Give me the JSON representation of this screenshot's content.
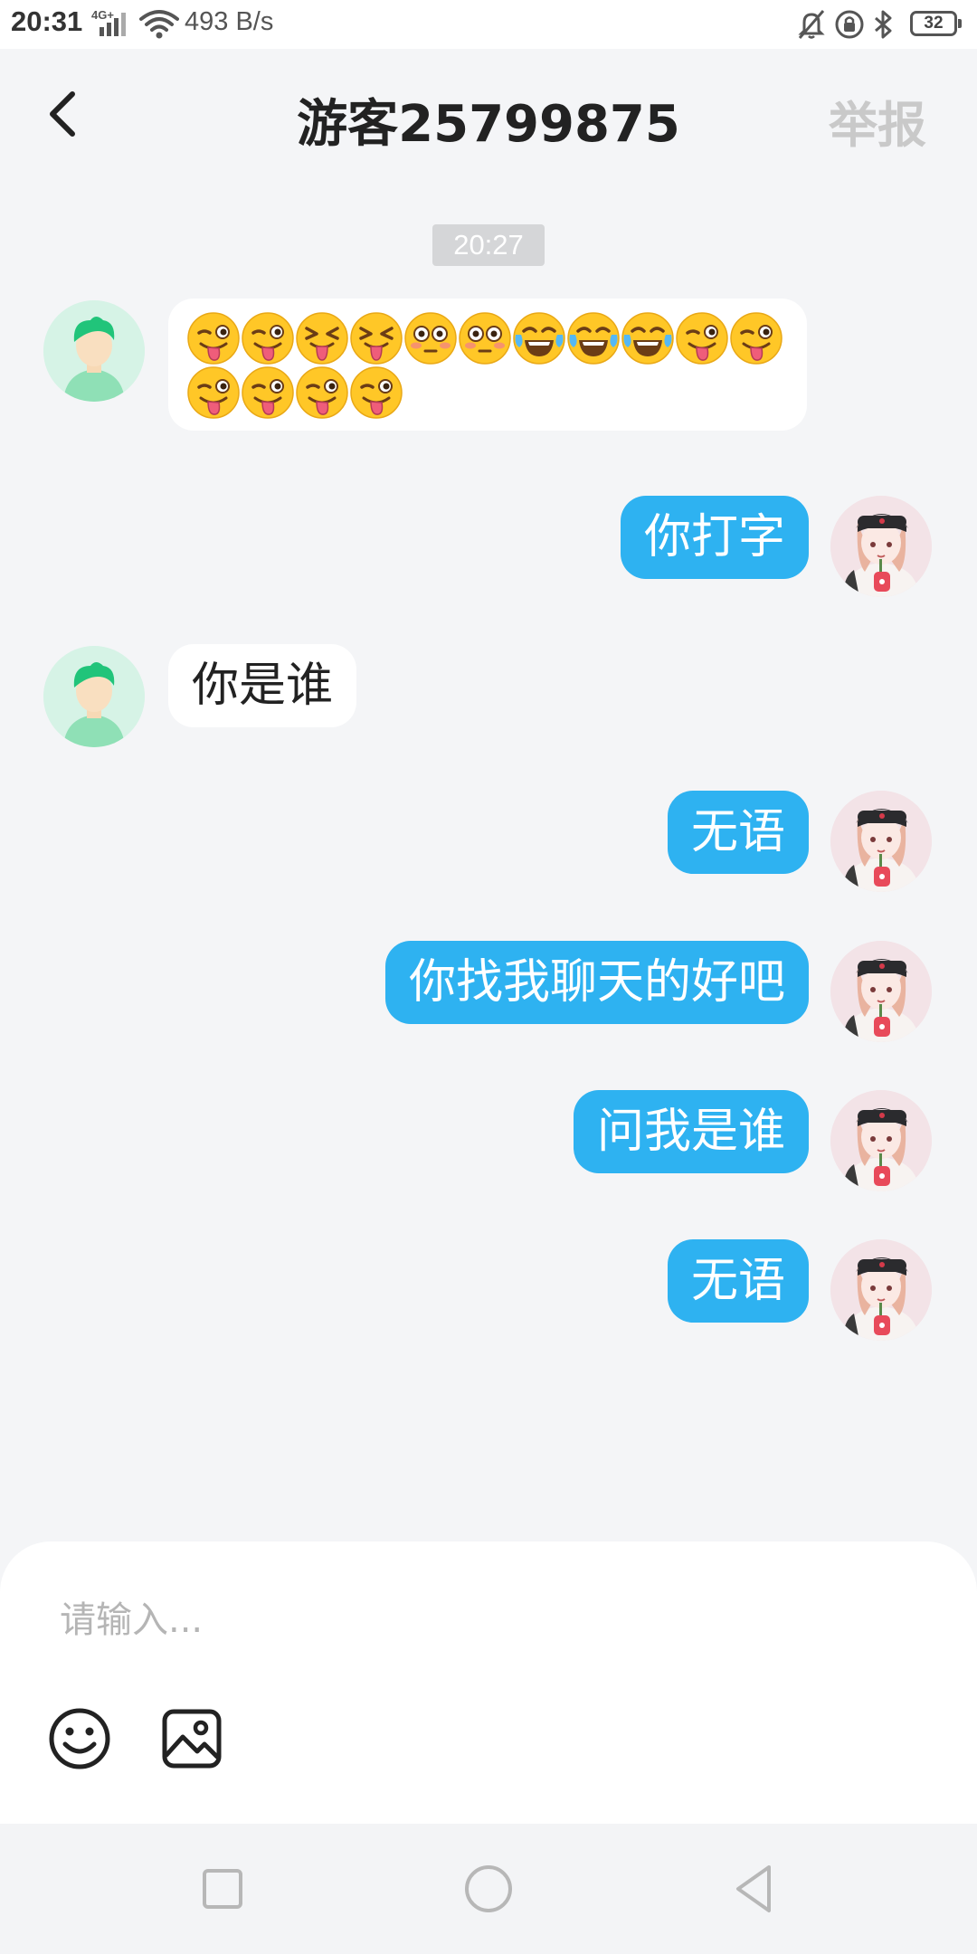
{
  "status_bar": {
    "time": "20:31",
    "network": "4G+",
    "speed": "493 B/s",
    "battery": "32",
    "icons": [
      "signal-icon",
      "wifi-icon",
      "mute-bell-icon",
      "lock-rotation-icon",
      "bluetooth-icon",
      "battery-icon"
    ]
  },
  "header": {
    "title": "游客25799875",
    "report_label": "举报",
    "back_icon": "chevron-left-icon"
  },
  "chat": {
    "timestamp": "20:27",
    "emoji_message": {
      "sender": "other",
      "emojis": [
        "winking-tongue",
        "winking-tongue",
        "squinting-tongue",
        "squinting-tongue",
        "flushed",
        "flushed",
        "tears-of-joy",
        "tears-of-joy",
        "tears-of-joy",
        "winking-tongue",
        "winking-tongue",
        "winking-tongue",
        "winking-tongue",
        "winking-tongue",
        "winking-tongue"
      ]
    },
    "messages": [
      {
        "sender": "me",
        "text": "你打字"
      },
      {
        "sender": "other",
        "text": "你是谁"
      },
      {
        "sender": "me",
        "text": "无语"
      },
      {
        "sender": "me",
        "text": "你找我聊天的好吧"
      },
      {
        "sender": "me",
        "text": "问我是谁"
      },
      {
        "sender": "me",
        "text": "无语"
      }
    ]
  },
  "input": {
    "placeholder": "请输入...",
    "value": "",
    "tools": [
      "smiley-icon",
      "image-icon"
    ]
  },
  "nav_bar": {
    "buttons": [
      "recent-apps-icon",
      "home-icon",
      "back-triangle-icon"
    ]
  },
  "colors": {
    "background": "#f4f5f7",
    "outgoing_bubble": "#2eb2f1",
    "incoming_bubble": "#ffffff",
    "report_text": "#c9c9c9",
    "timestamp_bg": "#d5d6d8"
  }
}
